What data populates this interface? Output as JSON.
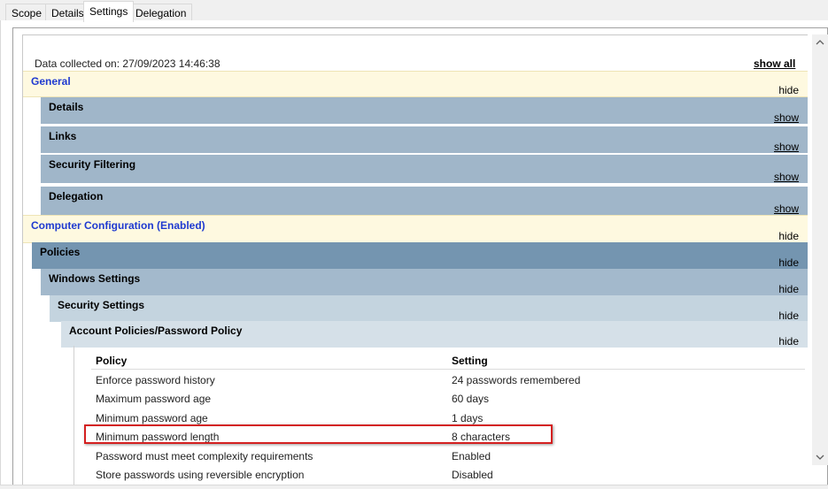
{
  "tabs": [
    {
      "label": "Scope"
    },
    {
      "label": "Details"
    },
    {
      "label": "Settings"
    },
    {
      "label": "Delegation"
    }
  ],
  "report": {
    "collected": "Data collected on: 27/09/2023 14:46:38",
    "show_all": "show all",
    "sections": [
      {
        "title": "General",
        "toggle": "hide"
      },
      {
        "title": "Details",
        "toggle": "show"
      },
      {
        "title": "Links",
        "toggle": "show"
      },
      {
        "title": "Security Filtering",
        "toggle": "show"
      },
      {
        "title": "Delegation",
        "toggle": "show"
      },
      {
        "title": "Computer Configuration (Enabled)",
        "toggle": "hide"
      },
      {
        "title": "Policies",
        "toggle": "hide"
      },
      {
        "title": "Windows Settings",
        "toggle": "hide"
      },
      {
        "title": "Security Settings",
        "toggle": "hide"
      },
      {
        "title": "Account Policies/Password Policy",
        "toggle": "hide"
      }
    ],
    "table": {
      "headers": [
        "Policy",
        "Setting"
      ],
      "rows": [
        [
          "Enforce password history",
          "24 passwords remembered"
        ],
        [
          "Maximum password age",
          "60 days"
        ],
        [
          "Minimum password age",
          "1 days"
        ],
        [
          "Minimum password length",
          "8 characters"
        ],
        [
          "Password must meet complexity requirements",
          "Enabled"
        ],
        [
          "Store passwords using reversible encryption",
          "Disabled"
        ]
      ]
    }
  },
  "colors": {
    "highlight": "#d42020",
    "yellow_section": "#fef9e0",
    "link_blue": "#1f3ad0"
  },
  "icons": {
    "scroll_up": "chevron-up-icon",
    "scroll_down": "chevron-down-icon"
  }
}
